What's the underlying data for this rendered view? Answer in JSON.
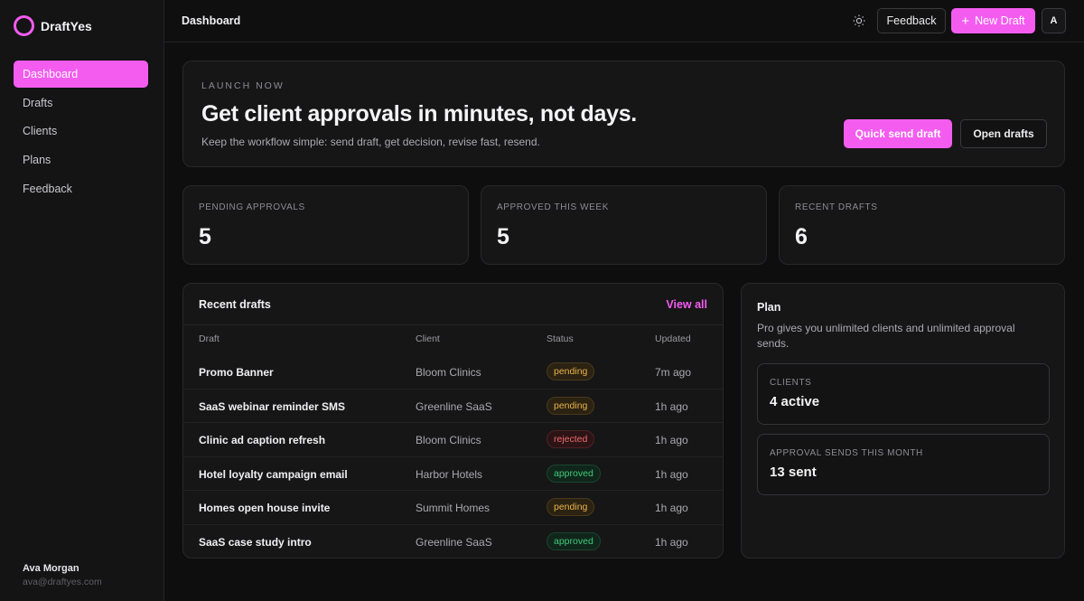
{
  "brand": {
    "name": "DraftYes",
    "accent": "#f45cf0"
  },
  "sidebar": {
    "items": [
      {
        "label": "Dashboard",
        "active": true
      },
      {
        "label": "Drafts",
        "active": false
      },
      {
        "label": "Clients",
        "active": false
      },
      {
        "label": "Plans",
        "active": false
      },
      {
        "label": "Feedback",
        "active": false
      }
    ],
    "user": {
      "name": "Ava Morgan",
      "email": "ava@draftyes.com"
    }
  },
  "topbar": {
    "title": "Dashboard",
    "theme_icon": "sun-icon",
    "feedback_label": "Feedback",
    "new_draft_label": "New Draft",
    "avatar_initial": "A"
  },
  "hero": {
    "eyebrow": "LAUNCH NOW",
    "title": "Get client approvals in minutes, not days.",
    "subtitle": "Keep the workflow simple: send draft, get decision, revise fast, resend.",
    "primary_label": "Quick send draft",
    "secondary_label": "Open drafts"
  },
  "stats": [
    {
      "label": "PENDING APPROVALS",
      "value": "5"
    },
    {
      "label": "APPROVED THIS WEEK",
      "value": "5"
    },
    {
      "label": "RECENT DRAFTS",
      "value": "6"
    }
  ],
  "recent_drafts": {
    "title": "Recent drafts",
    "view_all_label": "View all",
    "columns": [
      "Draft",
      "Client",
      "Status",
      "Updated"
    ],
    "rows": [
      {
        "draft": "Promo Banner",
        "client": "Bloom Clinics",
        "status": "pending",
        "updated": "7m ago"
      },
      {
        "draft": "SaaS webinar reminder SMS",
        "client": "Greenline SaaS",
        "status": "pending",
        "updated": "1h ago"
      },
      {
        "draft": "Clinic ad caption refresh",
        "client": "Bloom Clinics",
        "status": "rejected",
        "updated": "1h ago"
      },
      {
        "draft": "Hotel loyalty campaign email",
        "client": "Harbor Hotels",
        "status": "approved",
        "updated": "1h ago"
      },
      {
        "draft": "Homes open house invite",
        "client": "Summit Homes",
        "status": "pending",
        "updated": "1h ago"
      },
      {
        "draft": "SaaS case study intro",
        "client": "Greenline SaaS",
        "status": "approved",
        "updated": "1h ago"
      }
    ]
  },
  "plan": {
    "title": "Plan",
    "description": "Pro gives you unlimited clients and unlimited approval sends.",
    "clients_label": "CLIENTS",
    "clients_value": "4 active",
    "sends_label": "APPROVAL SENDS THIS MONTH",
    "sends_value": "13 sent"
  }
}
